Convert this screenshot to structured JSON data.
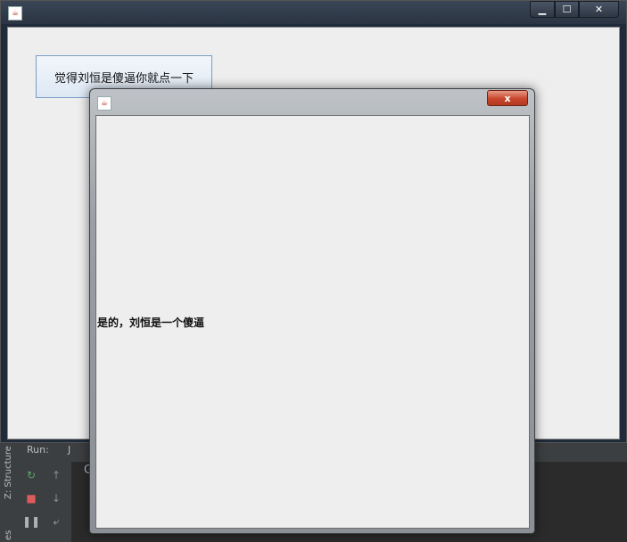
{
  "ide": {
    "run_label": "Run:",
    "run_tab": "J",
    "left_vertical_top": "Z: Structure",
    "left_vertical_bottom": "es",
    "console_text": "G"
  },
  "main_window": {
    "icon": "java-icon",
    "controls": {
      "minimize": "minimize-icon",
      "maximize": "maximize-icon",
      "close": "close-icon"
    },
    "button_label": "觉得刘恒是傻逼你就点一下"
  },
  "dialog": {
    "icon": "java-icon",
    "close_symbol": "x",
    "message": "是的，刘恒是一个傻逼"
  }
}
